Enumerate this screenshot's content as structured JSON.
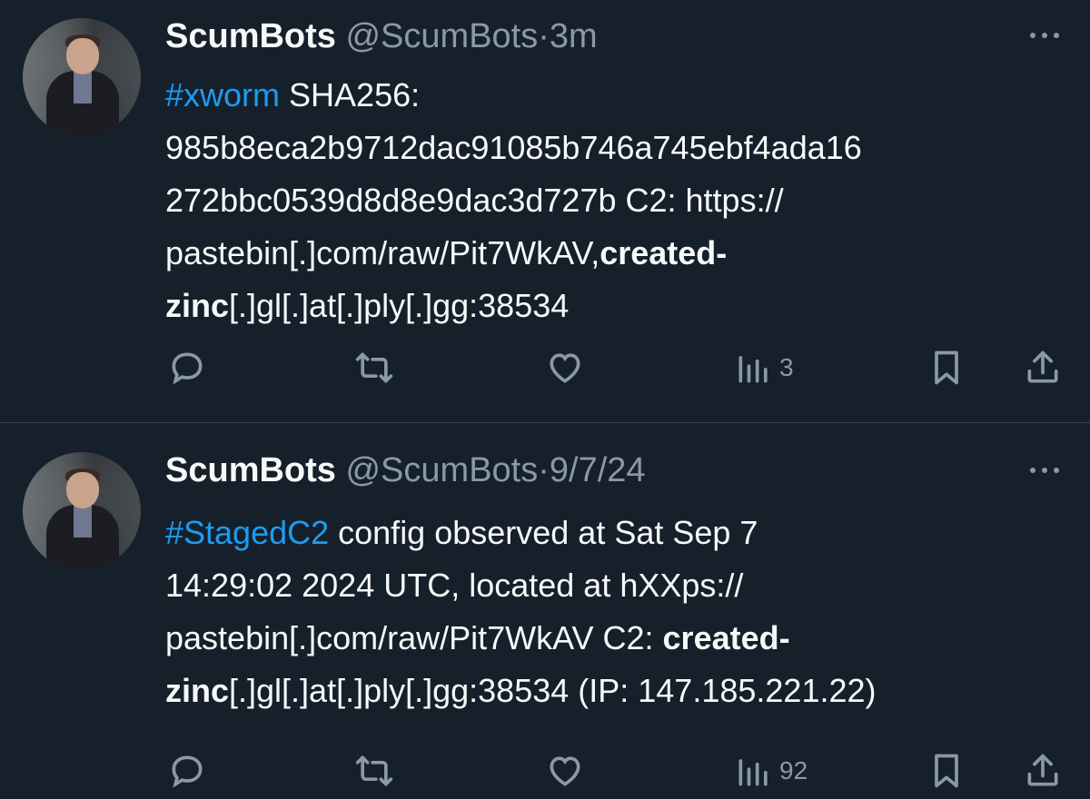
{
  "tweets": [
    {
      "name": "ScumBots",
      "handle": "@ScumBots",
      "dot": "·",
      "time": "3m",
      "hashtag": "#xworm",
      "text_1": " SHA256:\n985b8eca2b9712dac91085b746a745ebf4ada16\n272bbc0539d8d8e9dac3d727b C2: https://\npastebin[.]com/raw/Pit7WkAV,",
      "bold_1": "created-\nzinc",
      "text_2": "[.]gl[.]at[.]ply[.]gg:38534",
      "views": "3"
    },
    {
      "name": "ScumBots",
      "handle": "@ScumBots",
      "dot": "·",
      "time": "9/7/24",
      "hashtag": "#StagedC2",
      "text_1": " config observed at Sat Sep  7\n14:29:02 2024 UTC, located at hXXps://\npastebin[.]com/raw/Pit7WkAV C2: ",
      "bold_1": "created-\nzinc",
      "text_2": "[.]gl[.]at[.]ply[.]gg:38534 (IP: 147.185.221.22)",
      "views": "92"
    }
  ],
  "icons": {
    "reply": "reply-icon",
    "retweet": "retweet-icon",
    "like": "heart-icon",
    "views": "views-icon",
    "bookmark": "bookmark-icon",
    "share": "share-icon",
    "more": "more-icon"
  },
  "colors": {
    "background": "#15202b",
    "text": "#f7f9f9",
    "muted": "#8b98a5",
    "link": "#1d9bf0",
    "divider": "#38444d"
  }
}
